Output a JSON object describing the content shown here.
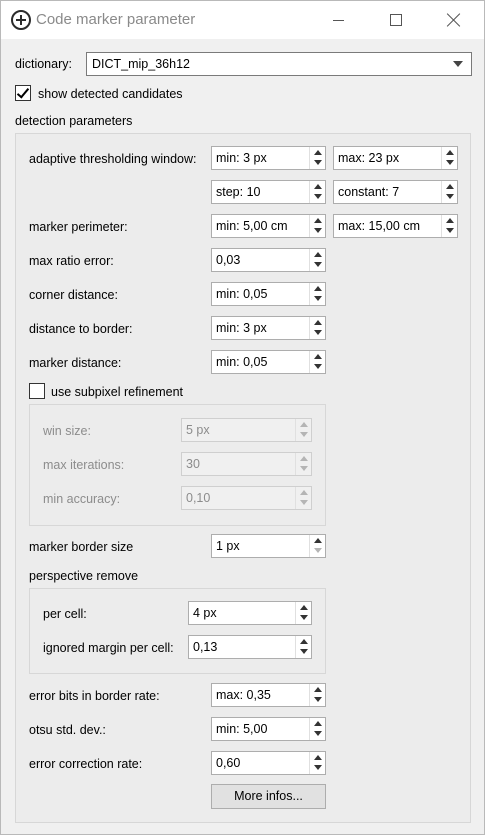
{
  "window": {
    "title": "Code marker parameter"
  },
  "dictionary": {
    "label": "dictionary:",
    "value": "DICT_mip_36h12"
  },
  "show_candidates": {
    "label": "show detected candidates",
    "checked": true
  },
  "detection": {
    "title": "detection parameters",
    "adaptive_window": {
      "label": "adaptive thresholding window:",
      "min": "min: 3 px",
      "max": "max: 23 px",
      "step": "step: 10",
      "constant": "constant: 7"
    },
    "marker_perimeter": {
      "label": "marker perimeter:",
      "min": "min: 5,00 cm",
      "max": "max: 15,00 cm"
    },
    "max_ratio_error": {
      "label": "max ratio error:",
      "value": "0,03"
    },
    "corner_distance": {
      "label": "corner distance:",
      "value": "min: 0,05"
    },
    "distance_to_border": {
      "label": "distance to border:",
      "value": "min: 3 px"
    },
    "marker_distance": {
      "label": "marker distance:",
      "value": "min: 0,05"
    },
    "subpixel": {
      "label": "use subpixel refinement",
      "checked": false,
      "win_size": {
        "label": "win size:",
        "value": "5 px"
      },
      "max_iterations": {
        "label": "max iterations:",
        "value": "30"
      },
      "min_accuracy": {
        "label": "min accuracy:",
        "value": "0,10"
      }
    },
    "marker_border_size": {
      "label": "marker border size",
      "value": "1 px"
    },
    "perspective": {
      "title": "perspective remove",
      "per_cell": {
        "label": "per cell:",
        "value": "4 px"
      },
      "ignored_margin": {
        "label": "ignored margin per cell:",
        "value": "0,13"
      }
    },
    "error_bits": {
      "label": "error bits in border rate:",
      "value": "max: 0,35"
    },
    "otsu": {
      "label": "otsu std. dev.:",
      "value": "min: 5,00"
    },
    "error_correction": {
      "label": "error correction rate:",
      "value": "0,60"
    },
    "more_button": "More infos..."
  },
  "icons": [
    "app-plus-icon",
    "minimize-icon",
    "maximize-icon",
    "close-icon",
    "chevron-down-icon",
    "checkmark-icon",
    "spin-up-arrow-icon",
    "spin-down-arrow-icon"
  ]
}
